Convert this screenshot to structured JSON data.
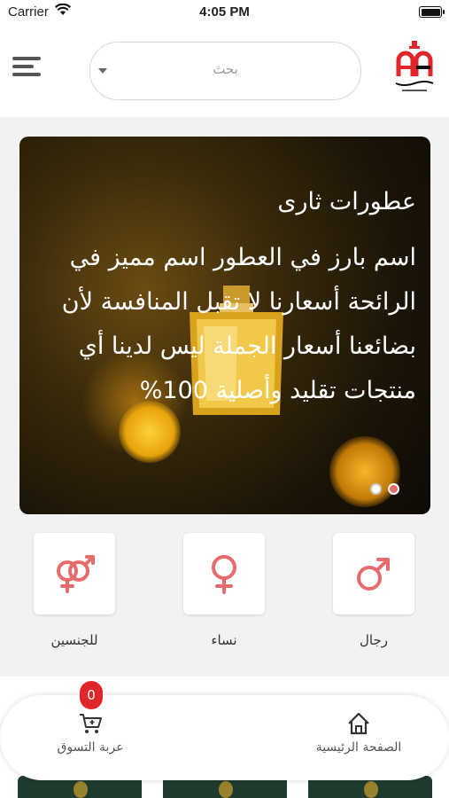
{
  "status_bar": {
    "carrier": "Carrier",
    "time": "4:05 PM"
  },
  "header": {
    "search_placeholder": "بحث"
  },
  "banner": {
    "title": "عطورات ثارى",
    "body": "اسم بارز في العطور اسم مميز في الرائحة أسعارنا لا تقبل المنافسة لأن بضائعنا أسعار الجملة ليس لدينا أي منتجات تقليد وأصلية 100%",
    "slides": 2,
    "active_slide": 2
  },
  "categories": [
    {
      "label": "رجال",
      "icon": "male-symbol-icon"
    },
    {
      "label": "نساء",
      "icon": "female-symbol-icon"
    },
    {
      "label": "للجنسين",
      "icon": "unisex-symbol-icon"
    }
  ],
  "nav": {
    "home_label": "الصفحة الرئيسية",
    "cart_label": "عربة التسوق",
    "cart_count": "0"
  },
  "colors": {
    "accent": "#e86b6b",
    "badge": "#e0262b",
    "banner_text": "#ffffff"
  }
}
